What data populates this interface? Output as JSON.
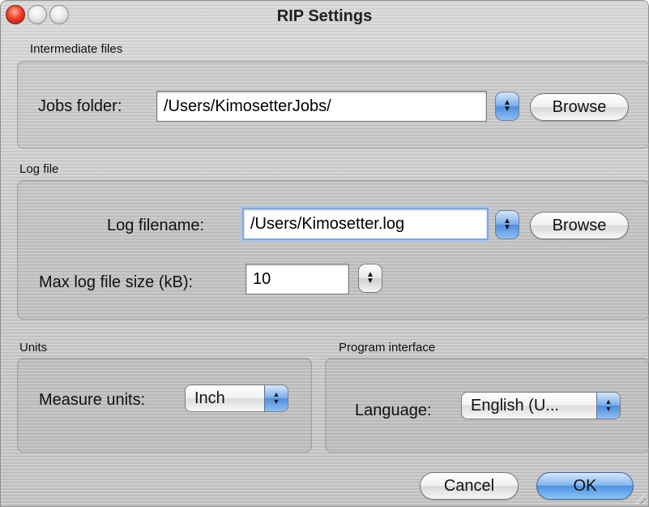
{
  "window": {
    "title": "RIP Settings"
  },
  "intermediate": {
    "group_label": "Intermediate files",
    "jobs_folder_label": "Jobs folder:",
    "jobs_folder_value": "/Users/KimosetterJobs/",
    "browse_label": "Browse"
  },
  "log": {
    "group_label": "Log file",
    "filename_label": "Log filename:",
    "filename_value": "/Users/Kimosetter.log",
    "browse_label": "Browse",
    "max_size_label": "Max log file size (kB):",
    "max_size_value": "10"
  },
  "units": {
    "group_label": "Units",
    "measure_label": "Measure units:",
    "measure_value": "Inch"
  },
  "program_interface": {
    "group_label": "Program interface",
    "language_label": "Language:",
    "language_value": "English (U..."
  },
  "footer": {
    "cancel_label": "Cancel",
    "ok_label": "OK"
  },
  "icons": {
    "close": "close-icon",
    "minimize": "minimize-icon",
    "zoom": "zoom-icon",
    "stepper": "stepper-icon",
    "popup_arrows": "updown-arrows-icon",
    "resize": "resize-grip-icon"
  },
  "colors": {
    "accent_blue": "#4f8fdc",
    "focus_ring": "#a9c6ee",
    "close_red": "#f0402a"
  }
}
